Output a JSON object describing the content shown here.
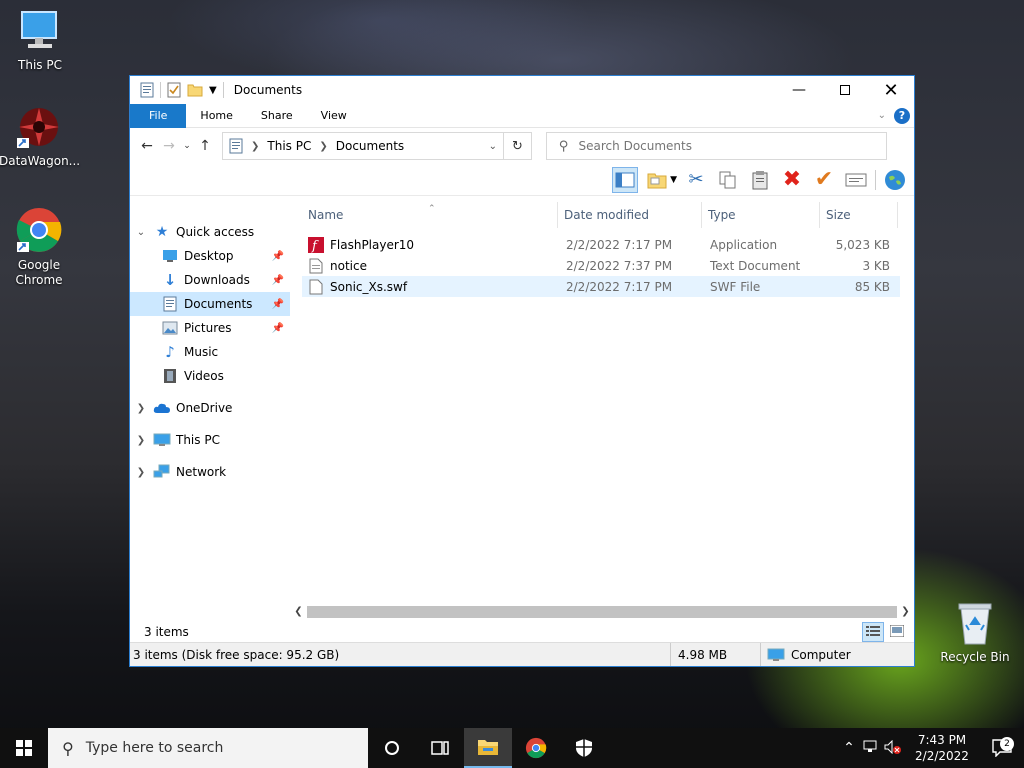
{
  "desktop": {
    "icons": [
      {
        "label": "This PC",
        "icon": "this-pc-icon"
      },
      {
        "label": "DataWagon...",
        "icon": "datawagon-icon"
      },
      {
        "label": "Google Chrome",
        "icon": "chrome-icon"
      },
      {
        "label": "Recycle Bin",
        "icon": "recycle-bin-icon"
      }
    ]
  },
  "window": {
    "title": "Documents",
    "ribbon_tabs": [
      "File",
      "Home",
      "Share",
      "View"
    ],
    "address": {
      "segments": [
        "This PC",
        "Documents"
      ]
    },
    "search": {
      "placeholder": "Search Documents"
    },
    "nav": {
      "quick_access": "Quick access",
      "quick_items": [
        {
          "label": "Desktop",
          "pinned": true
        },
        {
          "label": "Downloads",
          "pinned": true
        },
        {
          "label": "Documents",
          "pinned": true,
          "selected": true
        },
        {
          "label": "Pictures",
          "pinned": true
        },
        {
          "label": "Music",
          "pinned": false
        },
        {
          "label": "Videos",
          "pinned": false
        }
      ],
      "onedrive": "OneDrive",
      "this_pc": "This PC",
      "network": "Network"
    },
    "columns": {
      "name": "Name",
      "date": "Date modified",
      "type": "Type",
      "size": "Size"
    },
    "files": [
      {
        "name": "FlashPlayer10",
        "date": "2/2/2022 7:17 PM",
        "type": "Application",
        "size": "5,023 KB",
        "icon": "flash-icon"
      },
      {
        "name": "notice",
        "date": "2/2/2022 7:37 PM",
        "type": "Text Document",
        "size": "3 KB",
        "icon": "text-file-icon"
      },
      {
        "name": "Sonic_Xs.swf",
        "date": "2/2/2022 7:17 PM",
        "type": "SWF File",
        "size": "85 KB",
        "icon": "file-icon",
        "selected": true
      }
    ],
    "status": {
      "items": "3 items"
    },
    "details": {
      "summary": "3 items (Disk free space: 95.2 GB)",
      "size": "4.98 MB",
      "location": "Computer"
    }
  },
  "taskbar": {
    "search_placeholder": "Type here to search",
    "time": "7:43 PM",
    "date": "2/2/2022",
    "notifications": "2"
  }
}
